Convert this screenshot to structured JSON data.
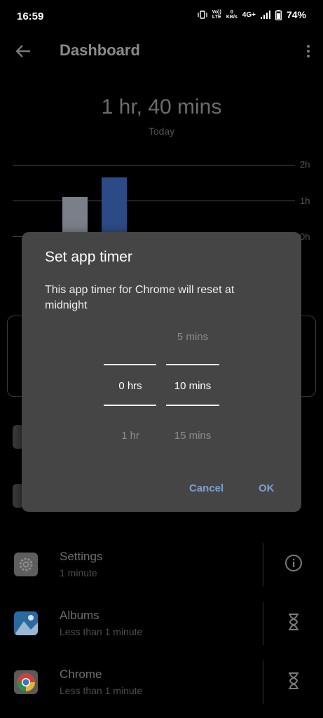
{
  "status_bar": {
    "time": "16:59",
    "volte_line1": "Vo))",
    "volte_line2": "LTE",
    "speed_value": "0",
    "speed_unit": "KB/s",
    "network": "4G+",
    "battery": "74%"
  },
  "app_bar": {
    "title": "Dashboard",
    "back_icon": "arrow-left-icon",
    "more_icon": "more-vert-icon"
  },
  "usage": {
    "total": "1 hr, 40 mins",
    "period": "Today"
  },
  "chart_data": {
    "type": "bar",
    "ticks": [
      "2h",
      "1h",
      "0h"
    ],
    "ylim": [
      0,
      2
    ],
    "values": [
      1.1,
      1.65
    ],
    "colors": [
      "#7b7f8a",
      "#2c4a86"
    ]
  },
  "app_list": [
    {
      "name": "Settings",
      "usage": "1 minute",
      "icon": "settings-icon",
      "action_icon": "info-icon"
    },
    {
      "name": "Albums",
      "usage": "Less than 1 minute",
      "icon": "albums-icon",
      "action_icon": "hourglass-icon"
    },
    {
      "name": "Chrome",
      "usage": "Less than 1 minute",
      "icon": "chrome-icon",
      "action_icon": "hourglass-icon"
    }
  ],
  "dialog": {
    "title": "Set app timer",
    "message": "This app timer for Chrome will reset at midnight",
    "hours_picker": {
      "above": "",
      "selected": "0 hrs",
      "below": "1 hr"
    },
    "minutes_picker": {
      "above": "5 mins",
      "selected": "10 mins",
      "below": "15 mins"
    },
    "cancel_label": "Cancel",
    "ok_label": "OK"
  },
  "colors": {
    "accent": "#7f9fd3",
    "dialog_bg": "#454545",
    "background": "#000000"
  }
}
